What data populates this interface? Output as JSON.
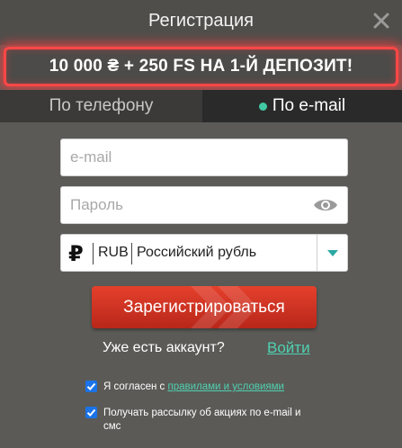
{
  "header": {
    "title": "Регистрация"
  },
  "promo": {
    "text": "10 000 ₴ + 250 FS НА 1-Й ДЕПОЗИТ!"
  },
  "tabs": [
    {
      "label": "По телефону",
      "active": false
    },
    {
      "label": "По e-mail",
      "active": true
    }
  ],
  "form": {
    "email_placeholder": "e-mail",
    "password_placeholder": "Пароль",
    "currency": {
      "symbol": "₽",
      "code": "RUB",
      "name": "Российский рубль"
    },
    "register_label": "Зарегистрироваться",
    "have_account": "Уже есть аккаунт?",
    "login_label": "Войти"
  },
  "checkboxes": {
    "agree_prefix": "Я согласен с ",
    "agree_link": "правилами и условиями",
    "newsletter": "Получать рассылку об акциях по e-mail и смс",
    "agree_checked": true,
    "newsletter_checked": true
  },
  "colors": {
    "accent": "#4fd1b0",
    "promo_border": "#ff4747",
    "register_bg": "#d33522",
    "checkbox": "#1a73e8"
  },
  "icons": [
    "close-icon",
    "eye-icon",
    "ruble-icon",
    "chevron-down-icon",
    "checkbox-checked-icon"
  ]
}
